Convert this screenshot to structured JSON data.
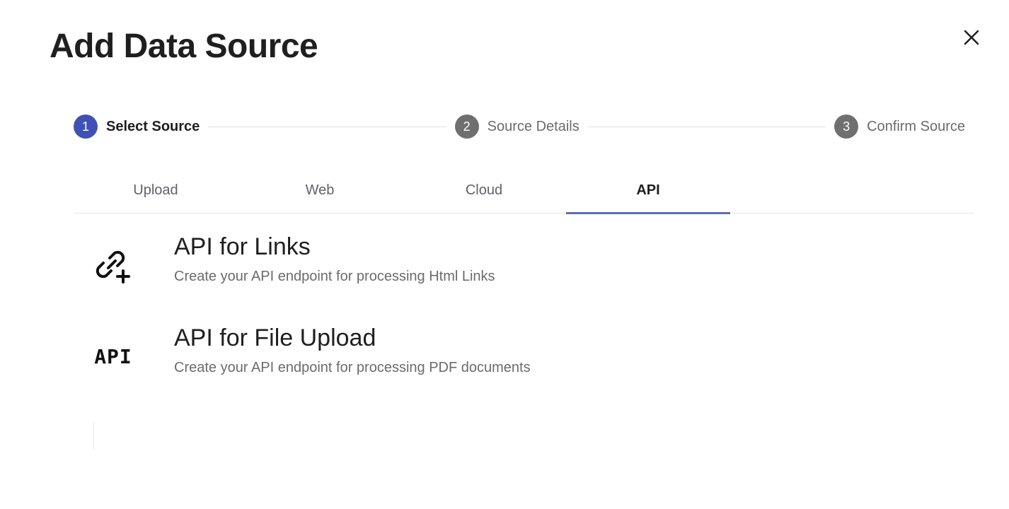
{
  "dialog": {
    "title": "Add Data Source",
    "close_icon": "close-icon"
  },
  "stepper": {
    "steps": [
      {
        "number": "1",
        "label": "Select Source",
        "active": true
      },
      {
        "number": "2",
        "label": "Source Details",
        "active": false
      },
      {
        "number": "3",
        "label": "Confirm Source",
        "active": false
      }
    ]
  },
  "tabs": [
    {
      "label": "Upload",
      "active": false
    },
    {
      "label": "Web",
      "active": false
    },
    {
      "label": "Cloud",
      "active": false
    },
    {
      "label": "API",
      "active": true
    }
  ],
  "options": [
    {
      "icon": "link-add-icon",
      "title": "API for Links",
      "description": "Create your API endpoint for processing Html Links"
    },
    {
      "icon": "api-icon",
      "icon_text": "API",
      "title": "API for File Upload",
      "description": "Create your API endpoint for processing PDF documents"
    }
  ],
  "colors": {
    "active_step": "#3f51b5",
    "inactive_step": "#6f6f6f",
    "tab_indicator": "#5c6bc0"
  }
}
